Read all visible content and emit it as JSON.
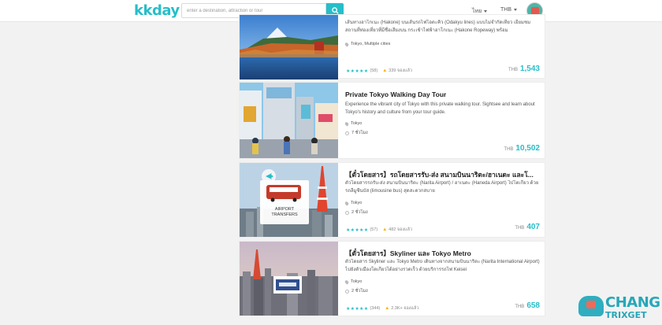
{
  "header": {
    "logo": "kkday",
    "search_placeholder": "enter a destination, attraction or tour",
    "language": "ไทย",
    "currency": "THB"
  },
  "cards": [
    {
      "title": "",
      "desc": "เส้นทางฮาโกเนะ (Hakone) บนเส้นรถไฟโอดะคิว (Odakyu lines) แบบไม่จำกัดเที่ยว เยี่ยมชมสถานที่ท่องเที่ยวที่มีชื่อเสียงบน กระเช้าไฟฟ้าฮาโกเนะ (Hakone Ropeway) พร้อม",
      "location": "Tokyo, Multiple cities",
      "duration": "",
      "stars": "★★★★★",
      "reviews": "(58)",
      "booked": "339 จองแล้ว",
      "currency": "THB",
      "price": "1,543"
    },
    {
      "title": "Private Tokyo Walking Day Tour",
      "desc": "Experience the vibrant city of Tokyo with this private walking tour. Sightsee and learn about Tokyo's history and culture from your tour guide.",
      "location": "Tokyo",
      "duration": "7 ชั่วโมง",
      "stars": "",
      "reviews": "",
      "booked": "",
      "currency": "THB",
      "price": "10,502"
    },
    {
      "title": "【ตั๋วโดยสาร】รถโดยสารรับ-ส่ง สนามบินนาริตะ/ฮาเนดะ และโ...",
      "desc": "ตั๋วโดยสารรถรับ-ส่ง สนามบินนาริตะ (Narita Airport) / ฮาเนดะ (Haneda Airport) ไปโตเกียว ด้วยรถลีมูซีนบัส (limousine bus) สุดสะดวกสบาย",
      "location": "Tokyo",
      "duration": "2 ชั่วโมง",
      "stars": "★★★★★",
      "reviews": "(57)",
      "booked": "482 จองแล้ว",
      "currency": "THB",
      "price": "407",
      "badge": "AIRPORT TRANSFERS"
    },
    {
      "title": "【ตั๋วโดยสาร】Skyliner และ Tokyo Metro",
      "desc": "ตั๋วโดยสาร Skyliner และ Tokyo Metro เดินทางจากสนามบินนาริตะ (Narita International Airport) ไปยังตัวเมืองโตเกียวได้อย่างรวดเร็ว ด้วยบริการรถไฟ Keisei",
      "location": "Tokyo",
      "duration": "2 ชั่วโมง",
      "stars": "★★★★★",
      "reviews": "(344)",
      "booked": "2.3K+ จองแล้ว",
      "currency": "THB",
      "price": "658"
    }
  ],
  "watermark": {
    "line1": "CHANG",
    "line2": "TRIXGET"
  }
}
